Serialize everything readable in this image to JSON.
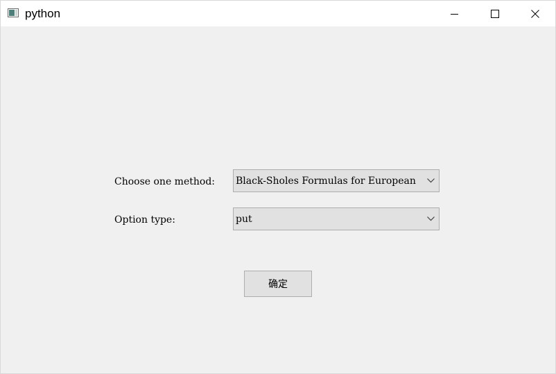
{
  "window": {
    "title": "python",
    "icon": "python-window-icon",
    "controls": {
      "minimize_icon": "minimize-icon",
      "maximize_icon": "maximize-icon",
      "close_icon": "close-icon"
    }
  },
  "form": {
    "method_label": "Choose one method:",
    "method_selected": "Black-Sholes Formulas for European",
    "type_label": "Option type:",
    "type_selected": "put",
    "confirm_label": "确定"
  },
  "colors": {
    "background": "#f0f0f0",
    "titlebar": "#ffffff",
    "control_face": "#e1e1e1",
    "control_border": "#adadad"
  }
}
